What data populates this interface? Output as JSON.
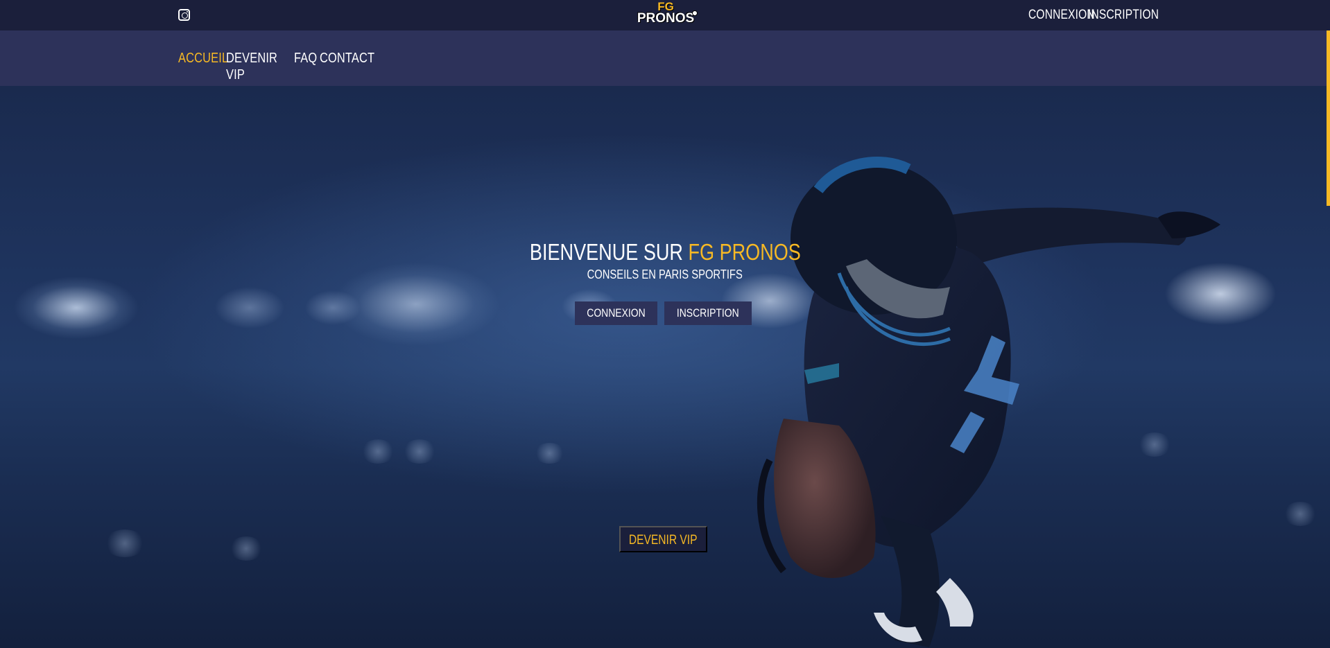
{
  "topbar": {
    "instagram_icon": "instagram-icon",
    "logo": {
      "line1": "FG",
      "line2": "PRONOS"
    },
    "login_label": "CONNEXION",
    "register_label": "INSCRIPTION"
  },
  "nav": {
    "items": [
      {
        "label": "ACCUEIL",
        "active": true
      },
      {
        "label": "DEVENIR VIP",
        "active": false
      },
      {
        "label": "FAQ",
        "active": false
      },
      {
        "label": "CONTACT",
        "active": false
      }
    ]
  },
  "hero": {
    "title_prefix": "BIENVENUE SUR ",
    "title_accent": "FG PRONOS",
    "subtitle": "CONSEILS EN PARIS SPORTIFS",
    "login_button": "CONNEXION",
    "register_button": "INSCRIPTION",
    "vip_button": "DEVENIR VIP"
  },
  "colors": {
    "accent": "#f7b924",
    "topbar": "#1b1f3b",
    "navbar": "#2d325a"
  }
}
